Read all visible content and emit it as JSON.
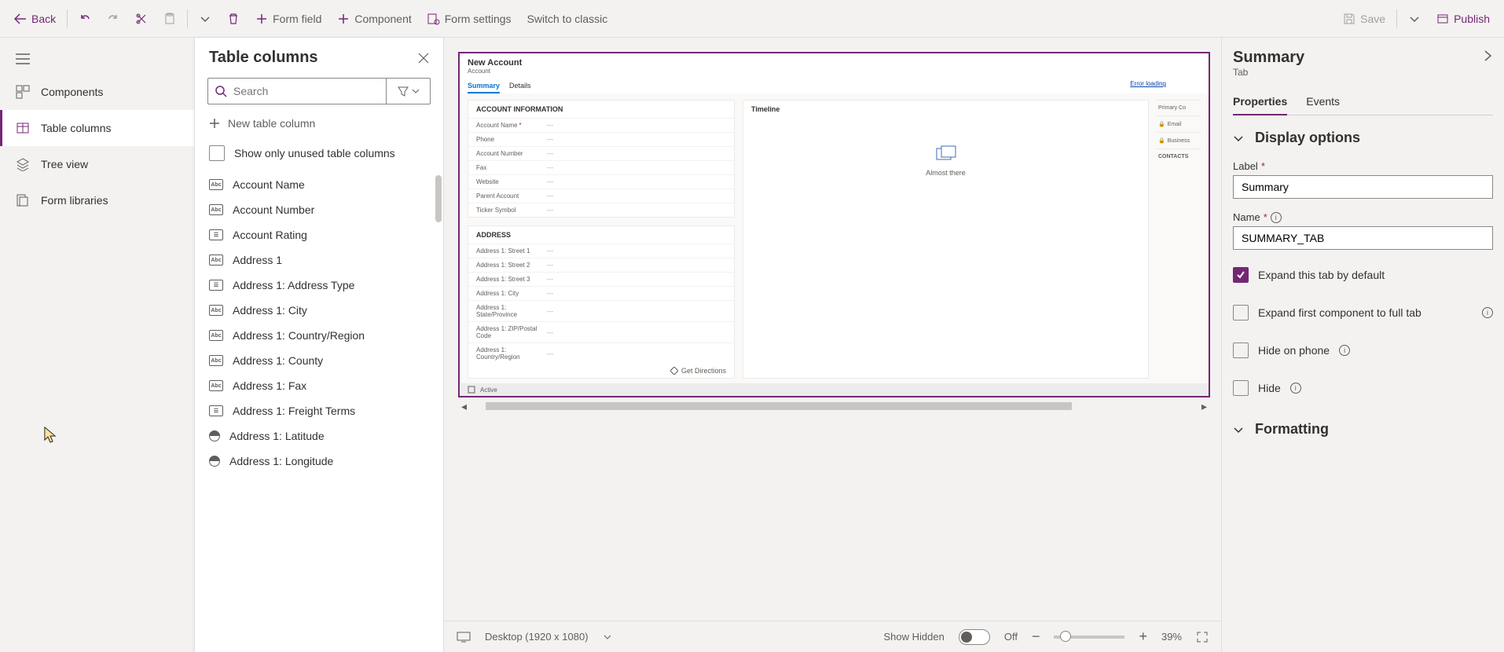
{
  "toolbar": {
    "back": "Back",
    "form_field": "Form field",
    "component": "Component",
    "form_settings": "Form settings",
    "switch_classic": "Switch to classic",
    "save": "Save",
    "publish": "Publish"
  },
  "left_nav": {
    "components": "Components",
    "table_columns": "Table columns",
    "tree_view": "Tree view",
    "form_libraries": "Form libraries"
  },
  "columns_panel": {
    "title": "Table columns",
    "search_placeholder": "Search",
    "new_column": "New table column",
    "show_unused": "Show only unused table columns",
    "items": [
      "Account Name",
      "Account Number",
      "Account Rating",
      "Address 1",
      "Address 1: Address Type",
      "Address 1: City",
      "Address 1: Country/Region",
      "Address 1: County",
      "Address 1: Fax",
      "Address 1: Freight Terms",
      "Address 1: Latitude",
      "Address 1: Longitude"
    ]
  },
  "form": {
    "title": "New Account",
    "entity": "Account",
    "tabs": {
      "summary": "Summary",
      "details": "Details"
    },
    "sections": {
      "account_info": "ACCOUNT INFORMATION",
      "address": "ADDRESS",
      "timeline": "Timeline"
    },
    "fields_account": [
      "Account Name",
      "Phone",
      "Account Number",
      "Fax",
      "Website",
      "Parent Account",
      "Ticker Symbol"
    ],
    "fields_address": [
      "Address 1: Street 1",
      "Address 1: Street 2",
      "Address 1: Street 3",
      "Address 1: City",
      "Address 1: State/Province",
      "Address 1: ZIP/Postal Code",
      "Address 1: Country/Region"
    ],
    "almost_there": "Almost there",
    "error_loading": "Error loading",
    "get_directions": "Get Directions",
    "status": "Active",
    "side": {
      "primary": "Primary Co",
      "email": "Email",
      "business": "Business",
      "contacts": "CONTACTS"
    }
  },
  "canvas_footer": {
    "device": "Desktop (1920 x 1080)",
    "show_hidden": "Show Hidden",
    "toggle_state": "Off",
    "zoom": "39%"
  },
  "props": {
    "title": "Summary",
    "subtitle": "Tab",
    "tab_properties": "Properties",
    "tab_events": "Events",
    "display_options": "Display options",
    "label_label": "Label",
    "label_value": "Summary",
    "name_label": "Name",
    "name_value": "SUMMARY_TAB",
    "expand_default": "Expand this tab by default",
    "expand_first": "Expand first component to full tab",
    "hide_phone": "Hide on phone",
    "hide": "Hide",
    "formatting": "Formatting"
  }
}
